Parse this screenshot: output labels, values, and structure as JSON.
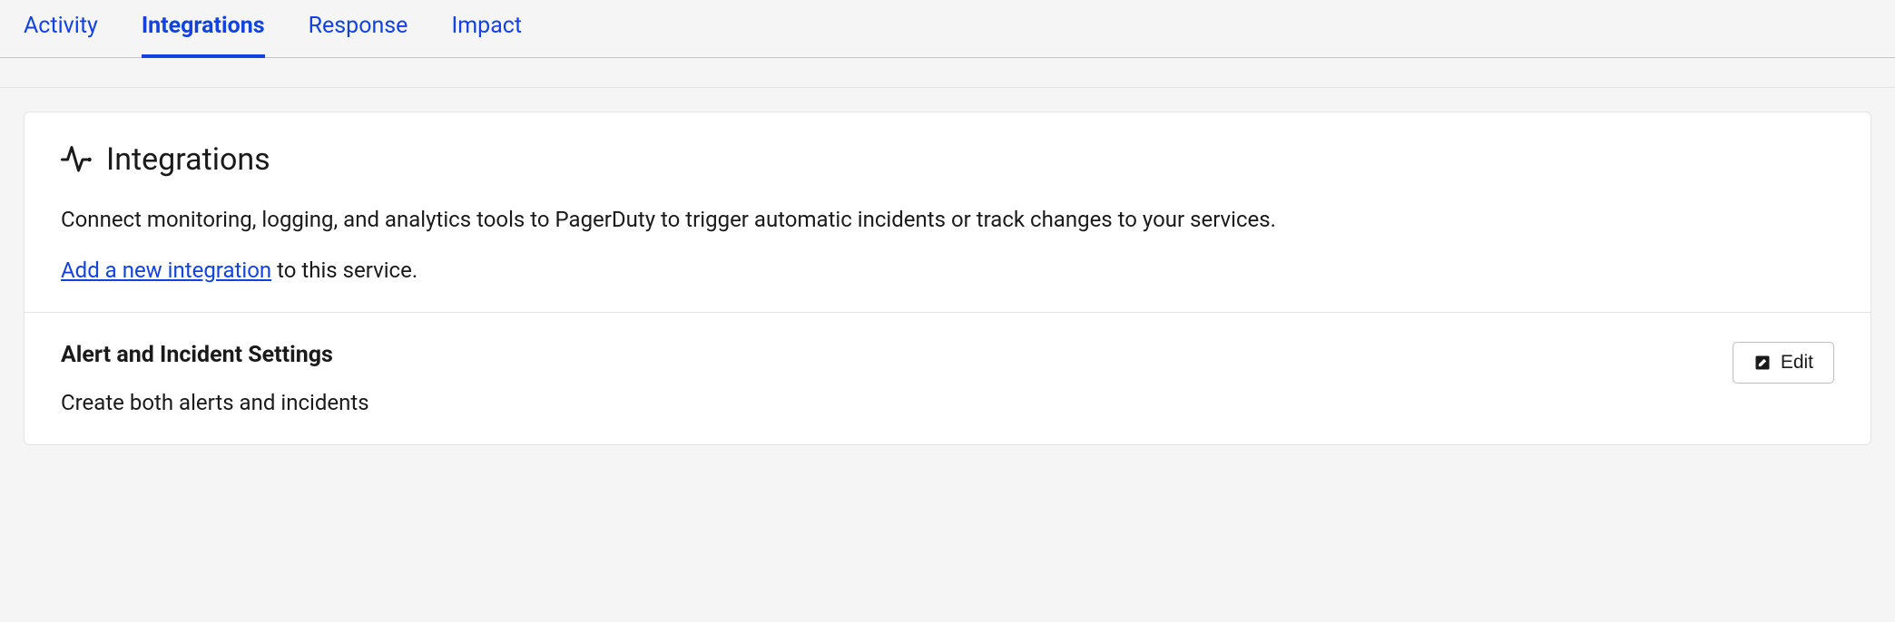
{
  "tabs": {
    "activity": "Activity",
    "integrations": "Integrations",
    "response": "Response",
    "impact": "Impact"
  },
  "integrations": {
    "title": "Integrations",
    "description": "Connect monitoring, logging, and analytics tools to PagerDuty to trigger automatic incidents or track changes to your services.",
    "link_text": "Add a new integration",
    "link_suffix": " to this service."
  },
  "settings": {
    "title": "Alert and Incident Settings",
    "value": "Create both alerts and incidents",
    "edit_label": "Edit"
  }
}
